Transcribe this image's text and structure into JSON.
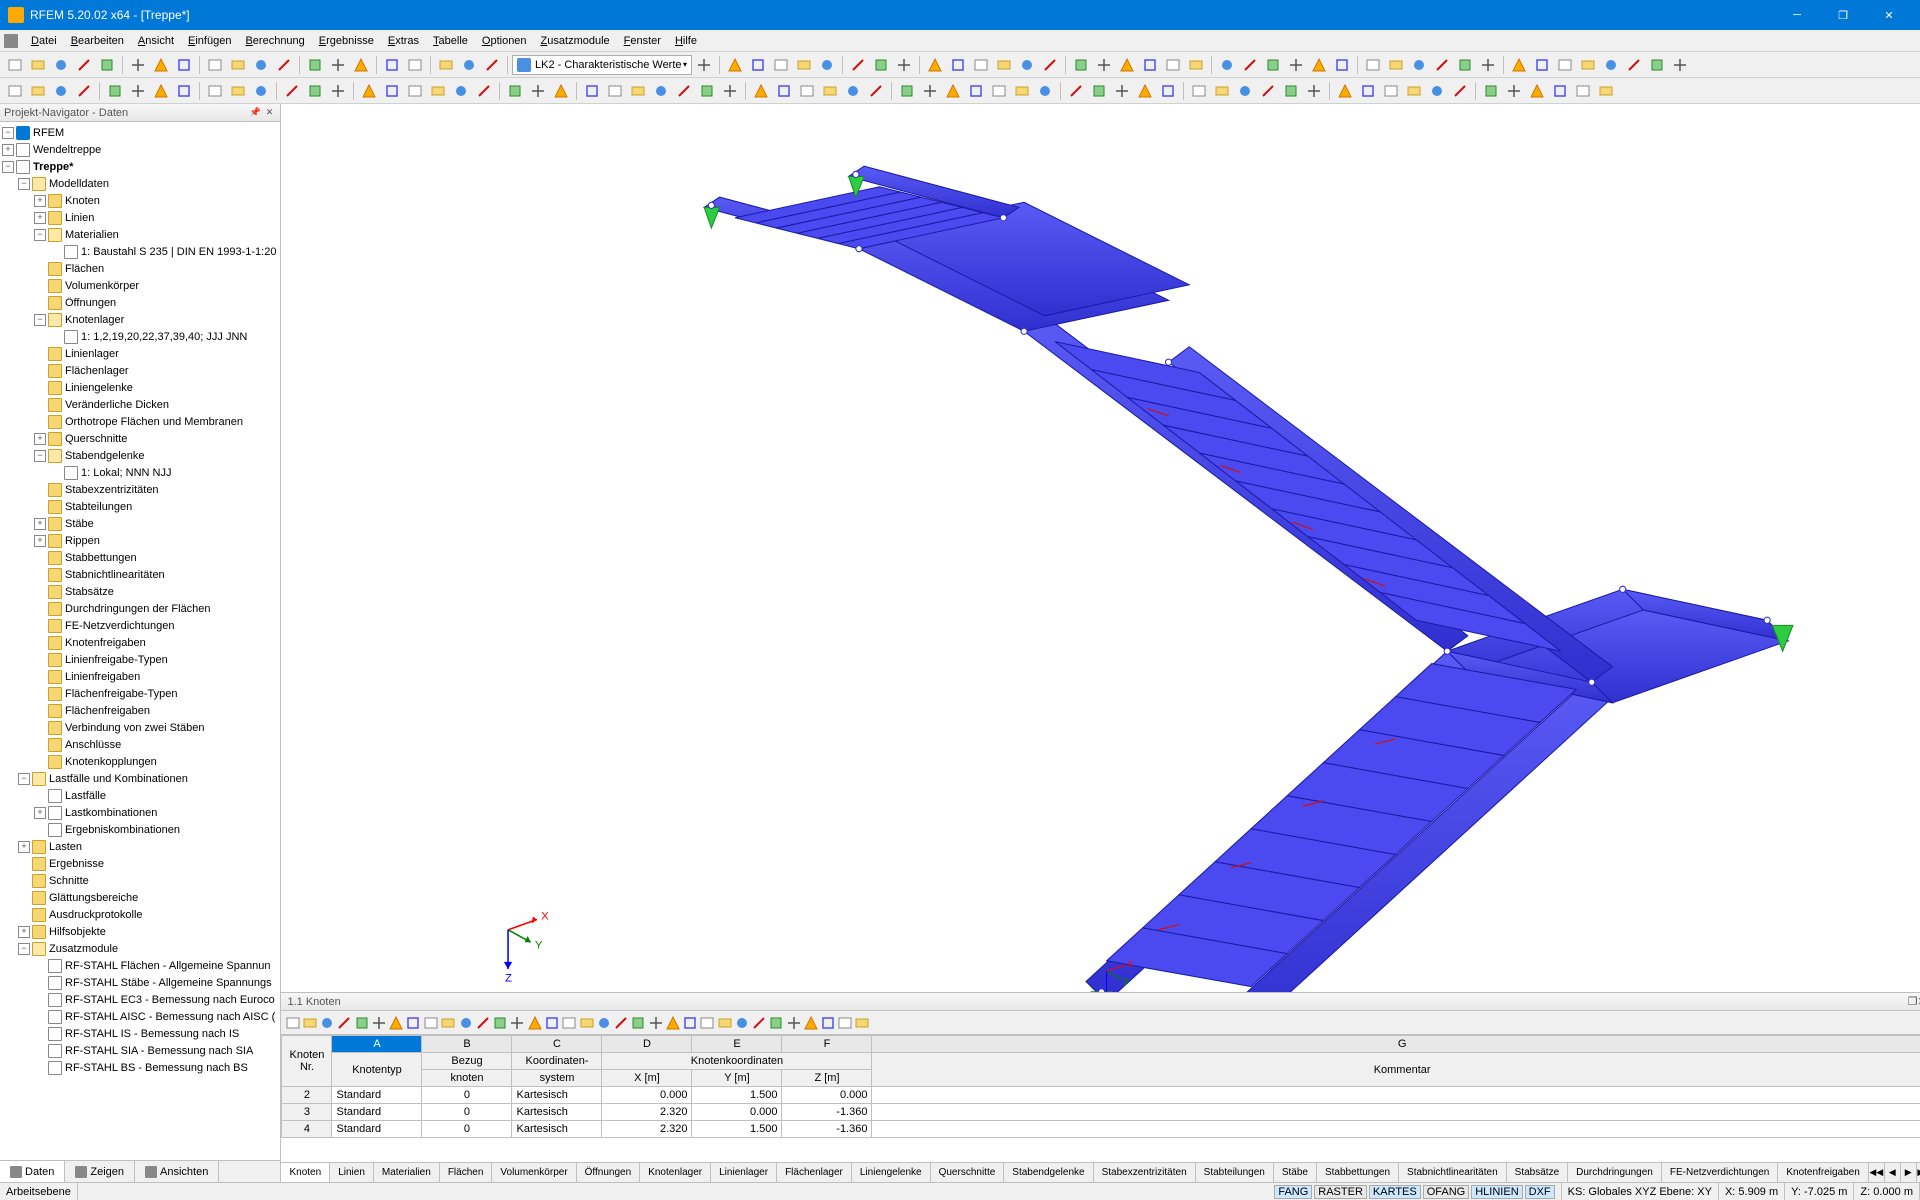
{
  "window": {
    "title": "RFEM 5.20.02 x64 - [Treppe*]"
  },
  "menu": [
    "Datei",
    "Bearbeiten",
    "Ansicht",
    "Einfügen",
    "Berechnung",
    "Ergebnisse",
    "Extras",
    "Tabelle",
    "Optionen",
    "Zusatzmodule",
    "Fenster",
    "Hilfe"
  ],
  "load_case_combo": "LK2 - Charakteristische Werte",
  "navigator": {
    "title": "Projekt-Navigator - Daten",
    "root": "RFEM",
    "models": [
      "Wendeltreppe",
      "Treppe*"
    ],
    "active_model": "Treppe*",
    "sections": {
      "modelldaten": "Modelldaten",
      "items": [
        {
          "label": "Knoten",
          "exp": true,
          "lvl": 2
        },
        {
          "label": "Linien",
          "exp": true,
          "lvl": 2
        },
        {
          "label": "Materialien",
          "exp": false,
          "open": true,
          "lvl": 2
        },
        {
          "label": "1: Baustahl S 235 | DIN EN 1993-1-1:20",
          "lvl": 3,
          "icon": "doc"
        },
        {
          "label": "Flächen",
          "lvl": 2
        },
        {
          "label": "Volumenkörper",
          "lvl": 2
        },
        {
          "label": "Öffnungen",
          "lvl": 2
        },
        {
          "label": "Knotenlager",
          "exp": false,
          "open": true,
          "lvl": 2
        },
        {
          "label": "1: 1,2,19,20,22,37,39,40; JJJ JNN",
          "lvl": 3,
          "icon": "doc"
        },
        {
          "label": "Linienlager",
          "lvl": 2
        },
        {
          "label": "Flächenlager",
          "lvl": 2
        },
        {
          "label": "Liniengelenke",
          "lvl": 2
        },
        {
          "label": "Veränderliche Dicken",
          "lvl": 2
        },
        {
          "label": "Orthotrope Flächen und Membranen",
          "lvl": 2
        },
        {
          "label": "Querschnitte",
          "exp": true,
          "lvl": 2
        },
        {
          "label": "Stabendgelenke",
          "exp": false,
          "open": true,
          "lvl": 2
        },
        {
          "label": "1: Lokal; NNN NJJ",
          "lvl": 3,
          "icon": "doc"
        },
        {
          "label": "Stabexzentrizitäten",
          "lvl": 2
        },
        {
          "label": "Stabteilungen",
          "lvl": 2
        },
        {
          "label": "Stäbe",
          "exp": true,
          "lvl": 2
        },
        {
          "label": "Rippen",
          "exp": true,
          "lvl": 2
        },
        {
          "label": "Stabbettungen",
          "lvl": 2
        },
        {
          "label": "Stabnichtlinearitäten",
          "lvl": 2
        },
        {
          "label": "Stabsätze",
          "lvl": 2
        },
        {
          "label": "Durchdringungen der Flächen",
          "lvl": 2
        },
        {
          "label": "FE-Netzverdichtungen",
          "lvl": 2
        },
        {
          "label": "Knotenfreigaben",
          "lvl": 2
        },
        {
          "label": "Linienfreigabe-Typen",
          "lvl": 2
        },
        {
          "label": "Linienfreigaben",
          "lvl": 2
        },
        {
          "label": "Flächenfreigabe-Typen",
          "lvl": 2
        },
        {
          "label": "Flächenfreigaben",
          "lvl": 2
        },
        {
          "label": "Verbindung von zwei Stäben",
          "lvl": 2
        },
        {
          "label": "Anschlüsse",
          "lvl": 2
        },
        {
          "label": "Knotenkopplungen",
          "lvl": 2
        }
      ],
      "lastfalle": "Lastfälle und Kombinationen",
      "lastfalle_items": [
        {
          "label": "Lastfälle",
          "lvl": 2,
          "icon": "doc"
        },
        {
          "label": "Lastkombinationen",
          "exp": true,
          "lvl": 2,
          "icon": "doc"
        },
        {
          "label": "Ergebniskombinationen",
          "lvl": 2,
          "icon": "doc"
        }
      ],
      "other": [
        {
          "label": "Lasten",
          "exp": true,
          "lvl": 1
        },
        {
          "label": "Ergebnisse",
          "lvl": 1
        },
        {
          "label": "Schnitte",
          "lvl": 1
        },
        {
          "label": "Glättungsbereiche",
          "lvl": 1
        },
        {
          "label": "Ausdruckprotokolle",
          "lvl": 1
        },
        {
          "label": "Hilfsobjekte",
          "exp": true,
          "lvl": 1
        },
        {
          "label": "Zusatzmodule",
          "exp": false,
          "open": true,
          "lvl": 1
        }
      ],
      "modules": [
        "RF-STAHL Flächen - Allgemeine Spannun",
        "RF-STAHL Stäbe - Allgemeine Spannungs",
        "RF-STAHL EC3 - Bemessung nach Euroco",
        "RF-STAHL AISC - Bemessung nach AISC (",
        "RF-STAHL IS - Bemessung nach IS",
        "RF-STAHL SIA - Bemessung nach SIA",
        "RF-STAHL BS - Bemessung nach BS"
      ]
    },
    "tabs": [
      "Daten",
      "Zeigen",
      "Ansichten"
    ]
  },
  "table": {
    "title": "1.1 Knoten",
    "col_letters": [
      "A",
      "B",
      "C",
      "D",
      "E",
      "F",
      "G"
    ],
    "header_row1": [
      "Knoten",
      "",
      "Bezug",
      "Koordinaten-",
      "Knotenkoordinaten",
      "",
      "",
      ""
    ],
    "header_row2": [
      "Nr.",
      "Knotentyp",
      "knoten",
      "system",
      "X [m]",
      "Y [m]",
      "Z [m]",
      "Kommentar"
    ],
    "rows": [
      {
        "nr": "2",
        "typ": "Standard",
        "bk": "0",
        "sys": "Kartesisch",
        "x": "0.000",
        "y": "1.500",
        "z": "0.000"
      },
      {
        "nr": "3",
        "typ": "Standard",
        "bk": "0",
        "sys": "Kartesisch",
        "x": "2.320",
        "y": "0.000",
        "z": "-1.360"
      },
      {
        "nr": "4",
        "typ": "Standard",
        "bk": "0",
        "sys": "Kartesisch",
        "x": "2.320",
        "y": "1.500",
        "z": "-1.360"
      }
    ],
    "tabs": [
      "Knoten",
      "Linien",
      "Materialien",
      "Flächen",
      "Volumenkörper",
      "Öffnungen",
      "Knotenlager",
      "Linienlager",
      "Flächenlager",
      "Liniengelenke",
      "Querschnitte",
      "Stabendgelenke",
      "Stabexzentrizitäten",
      "Stabteilungen",
      "Stäbe",
      "Stabbettungen",
      "Stabnichtlinearitäten",
      "Stabsätze",
      "Durchdringungen",
      "FE-Netzverdichtungen",
      "Knotenfreigaben"
    ]
  },
  "status": {
    "left": "Arbeitsebene",
    "toggles": [
      "FANG",
      "RASTER",
      "KARTES",
      "OFANG",
      "HLINIEN",
      "DXF"
    ],
    "ks": "KS: Globales XYZ  Ebene: XY",
    "x": "X: 5.909 m",
    "y": "Y: -7.025 m",
    "z": "Z: 0.000 m"
  },
  "axes": {
    "x": "X",
    "y": "Y",
    "z": "Z"
  }
}
